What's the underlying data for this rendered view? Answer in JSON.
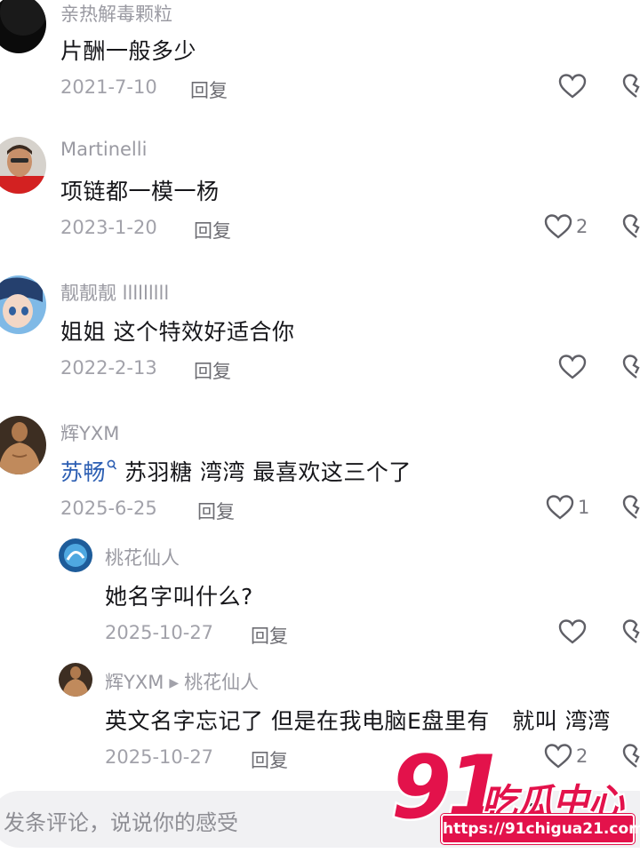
{
  "comments": [
    {
      "username": "亲热解毒颗粒",
      "text": "片酬一般多少",
      "date": "2021-7-10",
      "reply": "回复",
      "likes": ""
    },
    {
      "username": "Martinelli",
      "text": "项链都一模一杨",
      "date": "2023-1-20",
      "reply": "回复",
      "likes": "2"
    },
    {
      "username": "靓靓靓 lllllllll",
      "text": "姐姐 这个特效好适合你",
      "date": "2022-2-13",
      "reply": "回复",
      "likes": ""
    },
    {
      "username": "辉YXM",
      "mention": "苏畅",
      "text": "苏羽糖 湾湾 最喜欢这三个了",
      "date": "2025-6-25",
      "reply": "回复",
      "likes": "1"
    }
  ],
  "replies": [
    {
      "username": "桃花仙人",
      "text": "她名字叫什么?",
      "date": "2025-10-27",
      "reply": "回复",
      "likes": ""
    },
    {
      "username": "辉YXM",
      "reply_to": "桃花仙人",
      "text": "英文名字忘记了 但是在我电脑E盘里有　就叫 湾湾",
      "date": "2025-10-27",
      "reply": "回复",
      "likes": "2"
    }
  ],
  "input": {
    "placeholder": "发条评论，说说你的感受"
  },
  "watermark": {
    "number": "91",
    "brand": "吃瓜中心",
    "url": "https://91chigua21.com"
  },
  "icons": {
    "like": "heart-outline-icon",
    "dislike": "broken-heart-icon",
    "search": "search-icon"
  },
  "colors": {
    "mention": "#2d5fb3",
    "watermark": "#e3124b"
  }
}
